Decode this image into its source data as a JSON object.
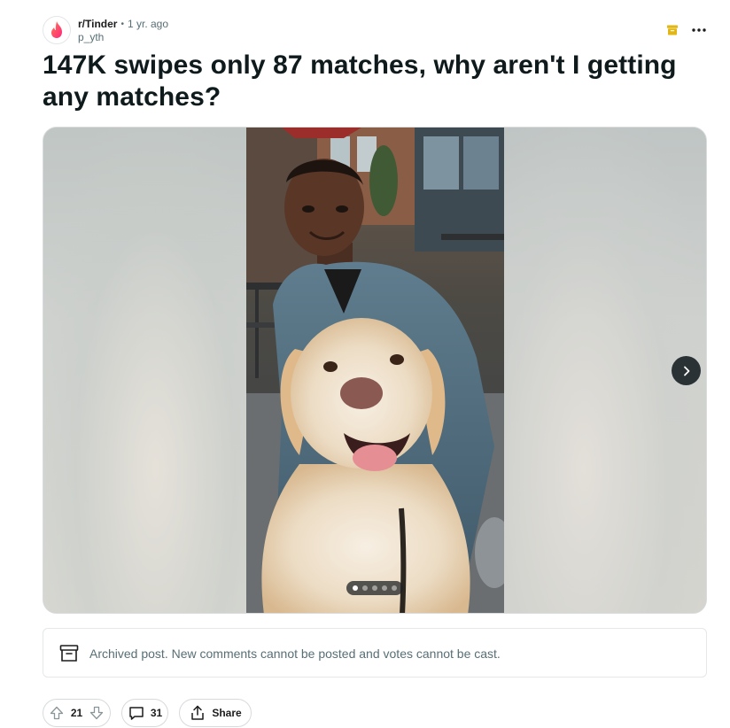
{
  "post": {
    "subreddit": "r/Tinder",
    "separator": "•",
    "time": "1 yr. ago",
    "author": "p_yth",
    "title": "147K swipes only 87 matches, why aren't I getting any matches?"
  },
  "media": {
    "pager_total": 5,
    "pager_active": 1
  },
  "notice": {
    "text": "Archived post. New comments cannot be posted and votes cannot be cast."
  },
  "actions": {
    "votes": "21",
    "comments": "31",
    "share_label": "Share"
  },
  "colors": {
    "tinder_brand": "#fe3c72",
    "archive_badge": "#e2b714",
    "next_button": "#2a3236"
  },
  "icons": {
    "subreddit_avatar": "tinder-flame-icon",
    "archived_badge": "archive-box-icon",
    "more": "more-horizontal-icon",
    "next": "chevron-right-icon",
    "notice": "archive-box-icon",
    "upvote": "upvote-arrow-icon",
    "downvote": "downvote-arrow-icon",
    "comments": "comment-bubble-icon",
    "share": "share-icon"
  }
}
